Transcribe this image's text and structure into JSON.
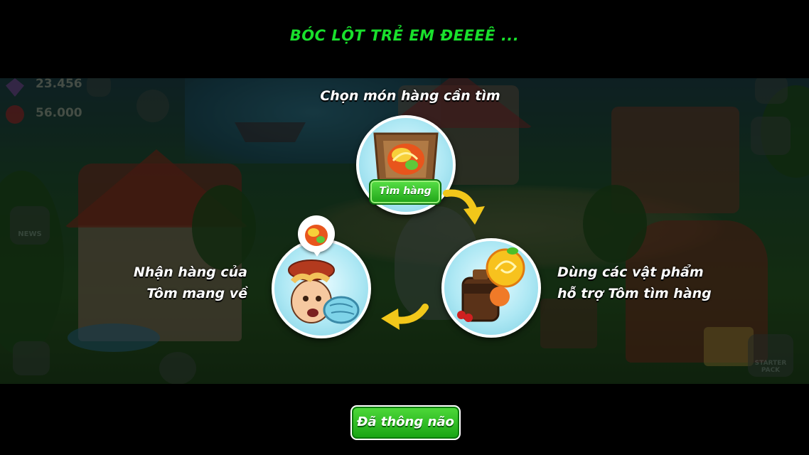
{
  "tutorial": {
    "title": "BÓC LỘT TRẺ EM ĐEEEÊ ...",
    "step1_caption": "Chọn món hàng cần tìm",
    "step1_button": "Tìm hàng",
    "step2_caption_line1": "Dùng các vật phẩm",
    "step2_caption_line2": "hỗ trợ Tôm tìm hàng",
    "step3_caption_line1": "Nhận hàng của",
    "step3_caption_line2": "Tôm mang về",
    "confirm_button": "Đã thông não"
  },
  "hud": {
    "gems": "23.456",
    "hearts": "56.000",
    "news_label": "NEWS",
    "starter_pack_label": "STARTER PACK"
  },
  "colors": {
    "title_green": "#19e02c",
    "button_green": "#1fa318",
    "bubble_blue": "#aee8f4",
    "arrow_yellow": "#f2c71a"
  }
}
